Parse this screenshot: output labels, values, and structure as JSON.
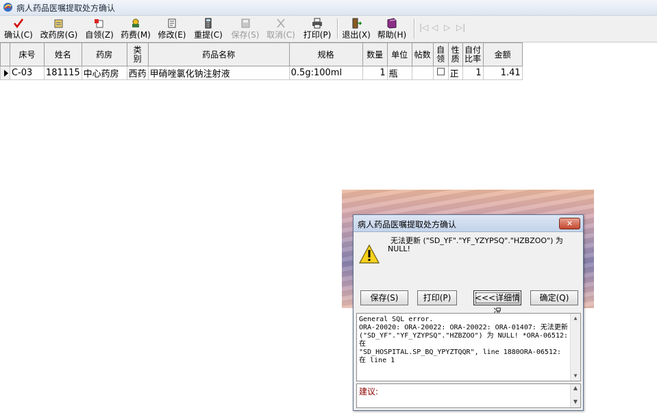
{
  "window": {
    "title": "病人药品医嘱提取处方确认",
    "app_icon": "app-logo-icon"
  },
  "toolbar": {
    "buttons": [
      {
        "label": "确认(C)",
        "icon": "checkmark-icon",
        "enabled": true
      },
      {
        "label": "改药房(G)",
        "icon": "change-pharmacy-icon",
        "enabled": true
      },
      {
        "label": "自领(Z)",
        "icon": "self-collect-icon",
        "enabled": true
      },
      {
        "label": "药费(M)",
        "icon": "medicine-fee-icon",
        "enabled": true
      },
      {
        "label": "修改(E)",
        "icon": "edit-icon",
        "enabled": true
      },
      {
        "label": "重提(C)",
        "icon": "calculator-icon",
        "enabled": true
      },
      {
        "label": "保存(S)",
        "icon": "save-icon",
        "enabled": false
      },
      {
        "label": "取消(C)",
        "icon": "cancel-icon",
        "enabled": false
      },
      {
        "label": "打印(P)",
        "icon": "printer-icon",
        "enabled": true
      },
      {
        "label": "退出(X)",
        "icon": "exit-icon",
        "enabled": true
      },
      {
        "label": "帮助(H)",
        "icon": "help-book-icon",
        "enabled": true
      }
    ],
    "nav": [
      "|◁",
      "◁",
      "▷",
      "▷|"
    ]
  },
  "grid": {
    "headers": {
      "bed": "床号",
      "name": "姓名",
      "pharmacy": "药房",
      "category": [
        "类",
        "别"
      ],
      "drug_name": "药品名称",
      "spec": "规格",
      "quantity": "数量",
      "unit": "单位",
      "doses": "帖数",
      "self_collect": [
        "自",
        "领"
      ],
      "nature": [
        "性",
        "质"
      ],
      "self_pay_ratio": [
        "自付",
        "比率"
      ],
      "amount": "金额"
    },
    "rows": [
      {
        "bed": "C-03",
        "name": "181115",
        "pharmacy": "中心药房",
        "category": "西药",
        "drug_name": "甲硝唑氯化钠注射液",
        "spec": "0.5g:100ml",
        "quantity": "1",
        "unit": "瓶",
        "doses": "",
        "self_collect": false,
        "nature": "正",
        "self_pay_ratio": "1",
        "amount": "1.41"
      }
    ]
  },
  "dialog": {
    "title": "病人药品医嘱提取处方确认",
    "close_label": "✕",
    "message_line1": "无法更新 (\"SD_YF\".\"YF_YZYPSQ\".\"HZBZOO\") 为",
    "message_line2": "NULL!",
    "buttons": {
      "save": "保存(S)",
      "print": "打印(P)",
      "details": "<<<详细情况",
      "ok": "确定(Q)"
    },
    "detail_text": "General SQL error.\nORA-20020: ORA-20022: ORA-20022: ORA-01407: 无法更新 (\"SD_YF\".\"YF_YZYPSQ\".\"HZBZOO\") 为 NULL! *ORA-06512: 在\n\"SD_HOSPITAL.SP_BQ_YPYZTQQR\", line 1880ORA-06512: 在 line 1",
    "suggestion_label": "建议:"
  },
  "colors": {
    "accent_red": "#c00000",
    "suggestion_label": "#8b0000",
    "dialog_title_bg": "#c3d3ea"
  }
}
